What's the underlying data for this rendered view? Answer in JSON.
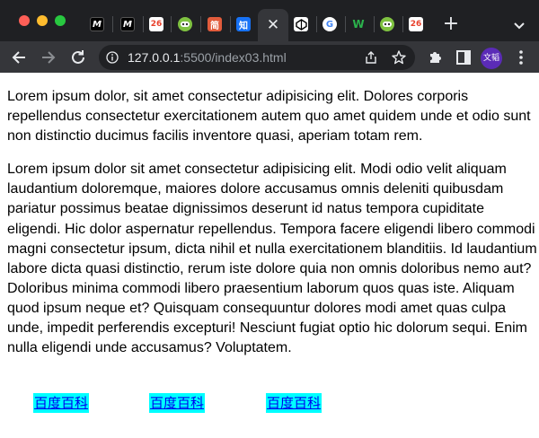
{
  "browser": {
    "tabs": [
      {
        "icon": "m-logo-icon",
        "letter": "M"
      },
      {
        "icon": "m-logo-icon",
        "letter": "M"
      },
      {
        "icon": "colorful-logo-icon",
        "letter": "26"
      },
      {
        "icon": "green-face-icon",
        "letter": ""
      },
      {
        "icon": "red-text-icon",
        "letter": "简"
      },
      {
        "icon": "blue-text-icon",
        "letter": "知"
      },
      {
        "icon": "codepen-icon",
        "letter": ""
      },
      {
        "icon": "google-icon",
        "letter": "G"
      },
      {
        "icon": "green-w-icon",
        "letter": "W"
      },
      {
        "icon": "green-face-icon",
        "letter": ""
      },
      {
        "icon": "colorful-logo-icon",
        "letter": "26"
      }
    ],
    "url_host": "127.0.0.1",
    "url_rest": ":5500/index03.html",
    "profile_label": "文韬"
  },
  "page": {
    "paragraphs": [
      "Lorem ipsum dolor, sit amet consectetur adipisicing elit. Dolores corporis repellendus consectetur exercitationem autem quo amet quidem unde et odio sunt non distinctio ducimus facilis inventore quasi, aperiam totam rem.",
      "Lorem ipsum dolor sit amet consectetur adipisicing elit. Modi odio velit aliquam laudantium doloremque, maiores dolore accusamus omnis deleniti quibusdam pariatur possimus beatae dignissimos deserunt id natus tempora cupiditate eligendi. Hic dolor aspernatur repellendus. Tempora facere eligendi libero commodi magni consectetur ipsum, dicta nihil et nulla exercitationem blanditiis. Id laudantium labore dicta quasi distinctio, rerum iste dolore quia non omnis doloribus nemo aut? Doloribus minima commodi libero praesentium laborum quos quas iste. Aliquam quod ipsum neque et? Quisquam consequuntur dolores modi amet quas culpa unde, impedit perferendis excepturi! Nesciunt fugiat optio hic dolorum sequi. Enim nulla eligendi unde accusamus? Voluptatem."
    ],
    "links": [
      "百度百科",
      "百度百科",
      "百度百科"
    ]
  }
}
